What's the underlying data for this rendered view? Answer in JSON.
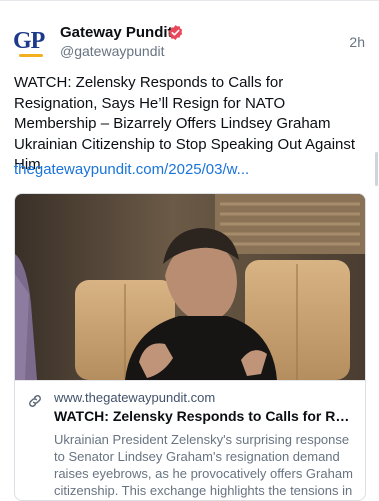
{
  "post": {
    "author": "Gateway Pundit",
    "handle": "@gatewaypundit",
    "time": "2h",
    "avatar_text": "GP",
    "text": "WATCH: Zelensky Responds to Calls for Resignation, Says He’ll Resign for NATO Membership – Bizarrely Offers Lindsey Graham Ukrainian Citizenship to Stop Speaking Out Against Him",
    "link": "thegatewaypundit.com/2025/03/w..."
  },
  "card": {
    "domain": "www.thegatewaypundit.com",
    "title": "WATCH: Zelensky Responds to Calls for Resign...",
    "description": "Ukrainian President Zelensky's surprising response to Senator Lindsey Graham's resignation demand raises eyebrows, as he provocatively offers Graham citizenship. This exchange highlights the tensions in ..."
  },
  "colors": {
    "link": "#1a74d9",
    "verified_badge": "#e8485a",
    "muted": "#687482"
  },
  "icons": {
    "verified": "verified-badge-icon",
    "link": "link-icon"
  }
}
